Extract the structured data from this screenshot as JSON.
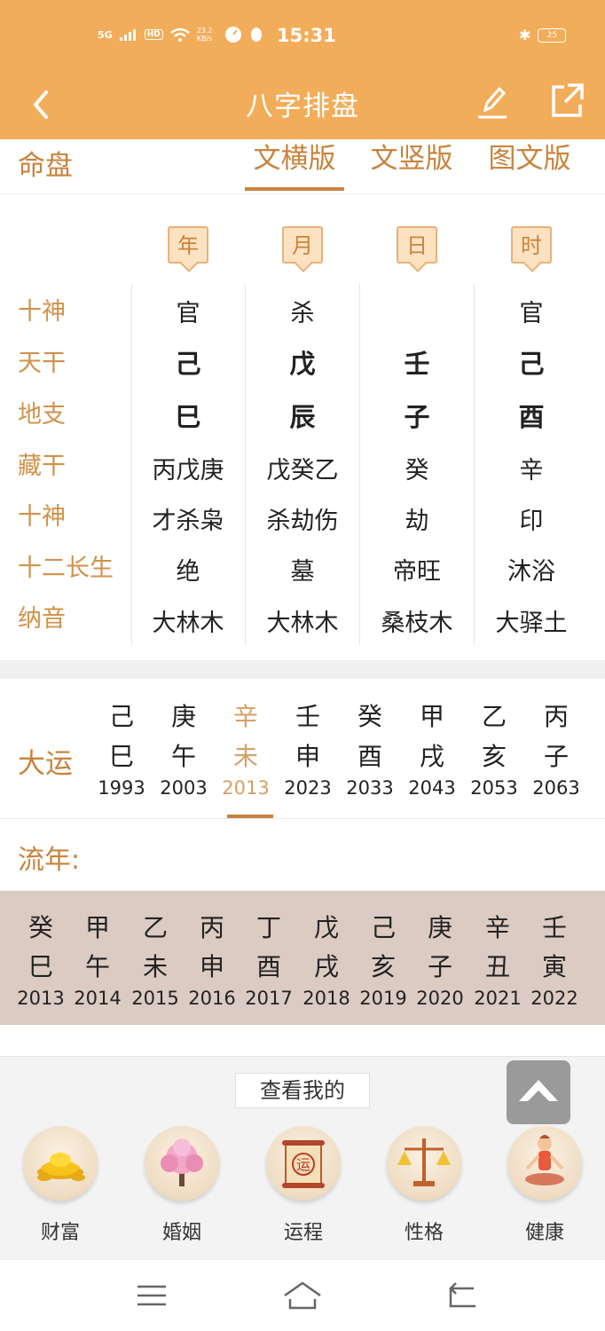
{
  "status": {
    "network": "5G",
    "hd": "HD",
    "speed": "23.2 KB/s",
    "time": "15:31",
    "battery": "25"
  },
  "appbar": {
    "title": "八字排盘"
  },
  "tabs": {
    "label": "命盘",
    "items": [
      "文横版",
      "文竖版",
      "图文版"
    ],
    "active": 0
  },
  "pillars": {
    "headers": [
      "年",
      "月",
      "日",
      "时"
    ],
    "row_labels": [
      "十神",
      "天干",
      "地支",
      "藏干",
      "十神",
      "十二长生",
      "纳音"
    ],
    "columns": [
      [
        "官",
        "己",
        "巳",
        "丙戊庚",
        "才杀枭",
        "绝",
        "大林木"
      ],
      [
        "杀",
        "戊",
        "辰",
        "戊癸乙",
        "杀劫伤",
        "墓",
        "大林木"
      ],
      [
        "",
        "壬",
        "子",
        "癸",
        "劫",
        "帝旺",
        "桑枝木"
      ],
      [
        "官",
        "己",
        "酉",
        "辛",
        "印",
        "沐浴",
        "大驿土"
      ]
    ]
  },
  "dayun": {
    "label": "大运",
    "items": [
      {
        "gan": "己",
        "zhi": "巳",
        "year": "1993"
      },
      {
        "gan": "庚",
        "zhi": "午",
        "year": "2003"
      },
      {
        "gan": "辛",
        "zhi": "未",
        "year": "2013"
      },
      {
        "gan": "壬",
        "zhi": "申",
        "year": "2023"
      },
      {
        "gan": "癸",
        "zhi": "酉",
        "year": "2033"
      },
      {
        "gan": "甲",
        "zhi": "戌",
        "year": "2043"
      },
      {
        "gan": "乙",
        "zhi": "亥",
        "year": "2053"
      },
      {
        "gan": "丙",
        "zhi": "子",
        "year": "2063"
      }
    ],
    "active": 2
  },
  "liunian": {
    "label": "流年:",
    "items": [
      {
        "gan": "癸",
        "zhi": "巳",
        "year": "2013"
      },
      {
        "gan": "甲",
        "zhi": "午",
        "year": "2014"
      },
      {
        "gan": "乙",
        "zhi": "未",
        "year": "2015"
      },
      {
        "gan": "丙",
        "zhi": "申",
        "year": "2016"
      },
      {
        "gan": "丁",
        "zhi": "酉",
        "year": "2017"
      },
      {
        "gan": "戊",
        "zhi": "戌",
        "year": "2018"
      },
      {
        "gan": "己",
        "zhi": "亥",
        "year": "2019"
      },
      {
        "gan": "庚",
        "zhi": "子",
        "year": "2020"
      },
      {
        "gan": "辛",
        "zhi": "丑",
        "year": "2021"
      },
      {
        "gan": "壬",
        "zhi": "寅",
        "year": "2022"
      }
    ]
  },
  "bottom": {
    "view_mine": "查看我的",
    "features": [
      {
        "label": "财富",
        "icon": "gold-ingot-icon"
      },
      {
        "label": "婚姻",
        "icon": "blossom-tree-icon"
      },
      {
        "label": "运程",
        "icon": "fortune-scroll-icon"
      },
      {
        "label": "性格",
        "icon": "balance-scale-icon"
      },
      {
        "label": "健康",
        "icon": "yoga-person-icon"
      }
    ]
  },
  "colors": {
    "accent": "#f2ad5a",
    "label": "#c9833c",
    "liunian_bg": "#dccbc2"
  }
}
